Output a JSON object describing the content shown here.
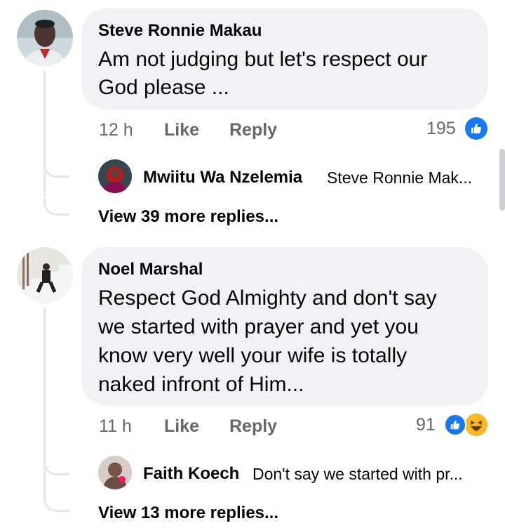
{
  "comments": [
    {
      "author": "Steve Ronnie Makau",
      "text_lines": [
        "Am not judging but let's respect our",
        "God please ..."
      ],
      "time": "12 h",
      "like_label": "Like",
      "reply_label": "Reply",
      "reaction_count": "195",
      "reactions": [
        "like-icon"
      ],
      "reply_preview": {
        "author": "Mwiitu Wa Nzelemia",
        "text": "Steve Ronnie Mak..."
      },
      "view_more": "View 39 more replies..."
    },
    {
      "author": "Noel Marshal",
      "text_lines": [
        "Respect God Almighty and don't say",
        "we started with prayer and yet you",
        "know very well your wife is totally",
        "naked infront of Him..."
      ],
      "time": "11 h",
      "like_label": "Like",
      "reply_label": "Reply",
      "reaction_count": "91",
      "reactions": [
        "like-icon",
        "haha-icon"
      ],
      "reply_preview": {
        "author": "Faith Koech",
        "text": "Don't say we started with pr..."
      },
      "view_more": "View 13 more replies..."
    }
  ],
  "colors": {
    "bubble": "#f0f2f5",
    "like_blue": "#1877f2",
    "haha_yellow": "#f7b928",
    "meta_gray": "#65676b"
  }
}
